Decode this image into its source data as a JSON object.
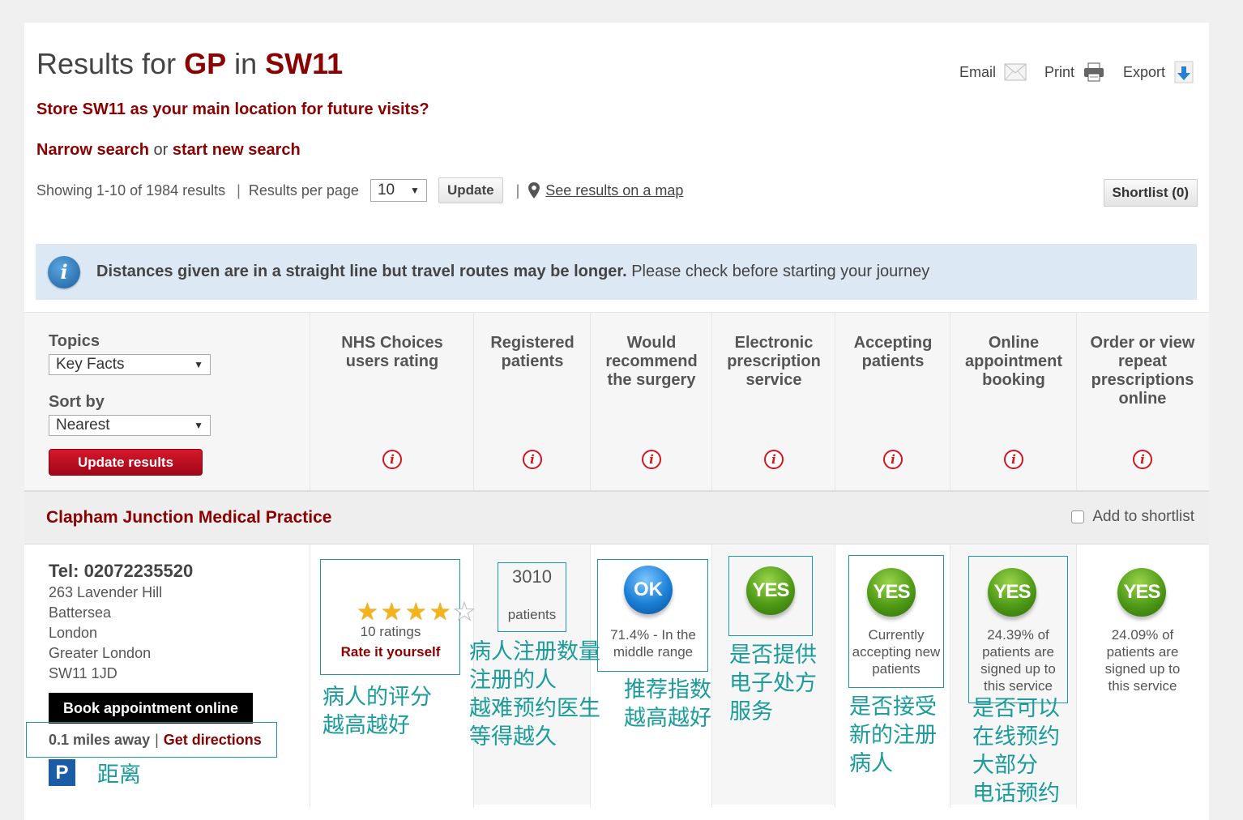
{
  "header": {
    "title_prefix": "Results for",
    "title_service": "GP",
    "title_in": "in",
    "title_location": "SW11",
    "store_prompt": "Store SW11 as your main location for future visits?",
    "narrow_search": "Narrow search",
    "or": "or",
    "start_new_search": "start new search"
  },
  "toolbar": {
    "email": "Email",
    "print": "Print",
    "export": "Export"
  },
  "results_controls": {
    "showing": "Showing 1-10 of 1984 results",
    "sep": "|",
    "per_page_label": "Results per page",
    "per_page_value": "10",
    "update": "Update",
    "map_link": "See results on a map",
    "shortlist": "Shortlist (0)"
  },
  "info_bar": {
    "icon_letter": "i",
    "bold": "Distances given are in a straight line but travel routes may be longer.",
    "rest": "Please check before starting your journey"
  },
  "filters": {
    "topics_label": "Topics",
    "topics_value": "Key Facts",
    "sort_label": "Sort by",
    "sort_value": "Nearest",
    "update_results": "Update results"
  },
  "columns": [
    "NHS Choices users rating",
    "Registered patients",
    "Would recommend the surgery",
    "Electronic prescription service",
    "Accepting patients",
    "Online appointment booking",
    "Order or view repeat prescriptions online"
  ],
  "result": {
    "name": "Clapham Junction Medical Practice",
    "add_to_shortlist": "Add to shortlist",
    "tel": "Tel: 02072235520",
    "address": [
      "263 Lavender Hill",
      "Battersea",
      "London",
      "Greater London",
      "SW11 1JD"
    ],
    "book_online": "Book appointment online",
    "distance": "0.1 miles away",
    "get_directions": "Get directions",
    "parking_letter": "P",
    "rating": {
      "stars": 4,
      "max_stars": 5,
      "ratings_count": "10 ratings",
      "rate_it": "Rate it yourself"
    },
    "registered_patients": {
      "count": "3010",
      "label": "patients"
    },
    "recommend": {
      "badge": "OK",
      "text": "71.4% - In the middle range"
    },
    "eps": {
      "badge": "YES"
    },
    "accepting": {
      "badge": "YES",
      "text": "Currently accepting new patients"
    },
    "online_booking": {
      "badge": "YES",
      "text": "24.39% of patients are signed up to this service"
    },
    "repeat_prescriptions": {
      "badge": "YES",
      "text": "24.09% of patients are signed up to this service"
    }
  },
  "annotations": {
    "rating": [
      "病人的评分",
      "越高越好"
    ],
    "registered": [
      "病人注册数量",
      "注册的人",
      "越难预约医生",
      "等得越久"
    ],
    "recommend": [
      "推荐指数",
      "越高越好"
    ],
    "eps": [
      "是否提供",
      "电子处方",
      "服务"
    ],
    "accepting": [
      "是否接受",
      "新的注册",
      "病人"
    ],
    "online": [
      "是否可以",
      "在线预约",
      "大部分",
      "电话预约"
    ],
    "distance": "距离"
  },
  "colors": {
    "brand_maroon": "#8b0000",
    "annotation_teal": "#1b9b9b",
    "info_bar_bg": "#dce8f4",
    "button_red": "#c8102e",
    "badge_yes": "#4f9a17",
    "badge_ok": "#1a7fd6"
  },
  "icons": [
    "envelope-icon",
    "printer-icon",
    "download-icon",
    "map-pin-icon",
    "info-icon",
    "star-icon",
    "parking-icon"
  ]
}
